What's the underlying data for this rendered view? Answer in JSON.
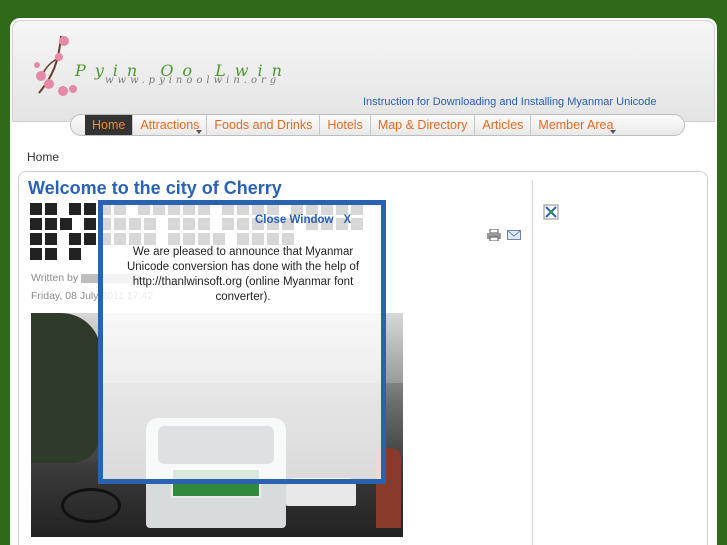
{
  "header": {
    "logo_text": "Pyin Oo Lwin",
    "logo_url": "www.pyinoolwin.org",
    "instruction_link": "Instruction for Downloading and Installing Myanmar Unicode"
  },
  "menu": {
    "items": [
      {
        "label": "Home",
        "active": true,
        "has_dropdown": false
      },
      {
        "label": "Attractions",
        "active": false,
        "has_dropdown": true
      },
      {
        "label": "Foods and Drinks",
        "active": false,
        "has_dropdown": false
      },
      {
        "label": "Hotels",
        "active": false,
        "has_dropdown": false
      },
      {
        "label": "Map & Directory",
        "active": false,
        "has_dropdown": false
      },
      {
        "label": "Articles",
        "active": false,
        "has_dropdown": false
      },
      {
        "label": "Member Area",
        "active": false,
        "has_dropdown": true
      }
    ]
  },
  "breadcrumb": "Home",
  "article": {
    "title": "Welcome to the city of Cherry",
    "written_by": "Written by",
    "date": "Friday, 08 July 2011 17:42"
  },
  "popup": {
    "close_label": "Close Window",
    "close_x": "X",
    "message": "We are pleased to announce that Myanmar Unicode conversion has done with the help of http://thanlwinsoft.org (online Myanmar font converter)."
  },
  "icons": {
    "print": "printer-icon",
    "email": "email-icon",
    "sidebar": "broken-image-icon"
  },
  "colors": {
    "background": "#2f6a1a",
    "menu_text": "#e4691f",
    "link": "#2a62b8",
    "popup_border": "#2a62b0"
  }
}
